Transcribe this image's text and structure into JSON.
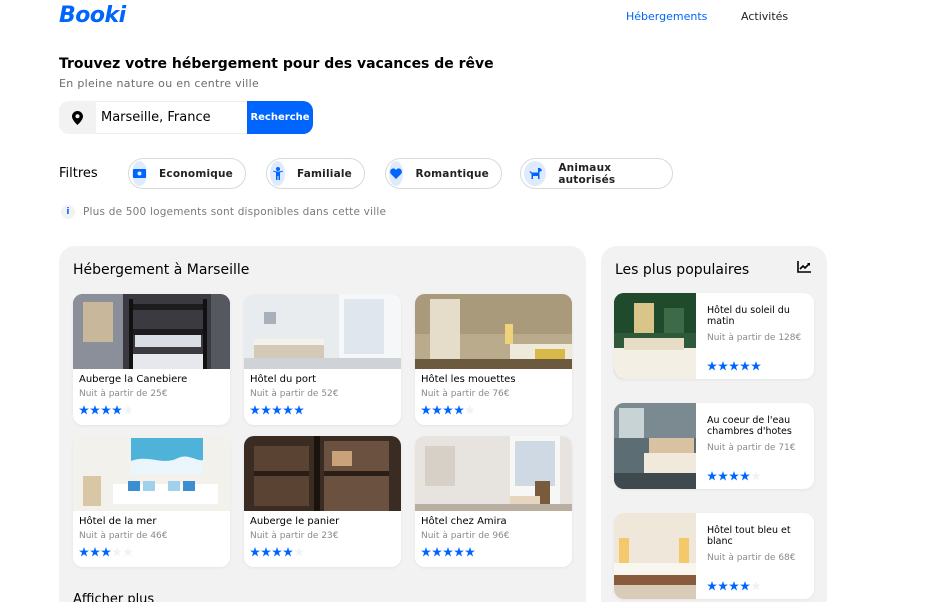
{
  "header": {
    "logo": "Booki",
    "nav": [
      {
        "label": "Hébergements",
        "active": true
      },
      {
        "label": "Activités",
        "active": false
      }
    ]
  },
  "hero": {
    "title": "Trouvez votre hébergement pour des vacances de rêve",
    "subtitle": "En pleine nature ou en centre ville"
  },
  "search": {
    "value": "Marseille, France",
    "button_label": "Recherche",
    "icon": "location-pin-icon"
  },
  "filters": {
    "label": "Filtres",
    "chips": [
      {
        "label": "Economique",
        "icon": "money-icon"
      },
      {
        "label": "Familiale",
        "icon": "child-icon"
      },
      {
        "label": "Romantique",
        "icon": "heart-icon"
      },
      {
        "label": "Animaux autorisés",
        "icon": "dog-icon"
      }
    ]
  },
  "info": {
    "text": "Plus de 500 logements sont disponibles dans cette ville"
  },
  "listings": {
    "title": "Hébergement à Marseille",
    "items": [
      {
        "name": "Auberge la Canebiere",
        "price": "Nuit à partir de 25€",
        "rating": 4
      },
      {
        "name": "Hôtel du port",
        "price": "Nuit à partir de 52€",
        "rating": 5
      },
      {
        "name": "Hôtel les mouettes",
        "price": "Nuit à partir de 76€",
        "rating": 4
      },
      {
        "name": "Hôtel de la mer",
        "price": "Nuit à partir de 46€",
        "rating": 3
      },
      {
        "name": "Auberge le panier",
        "price": "Nuit à partir de 23€",
        "rating": 4
      },
      {
        "name": "Hôtel chez Amira",
        "price": "Nuit à partir de 96€",
        "rating": 5
      }
    ],
    "more_label": "Afficher plus"
  },
  "popular": {
    "title": "Les plus populaires",
    "icon": "trend-chart-icon",
    "items": [
      {
        "name": "Hôtel du soleil du matin",
        "price": "Nuit à partir de 128€",
        "rating": 5
      },
      {
        "name": "Au coeur de l'eau chambres d'hotes",
        "price": "Nuit à partir de 71€",
        "rating": 4
      },
      {
        "name": "Hôtel tout bleu et blanc",
        "price": "Nuit à partir de 68€",
        "rating": 4
      }
    ]
  },
  "colors": {
    "accent": "#0065FC",
    "chip_icon_bg": "#DEEBFF",
    "panel_bg": "#F2F2F2",
    "star_empty": "#F2F2F2"
  }
}
